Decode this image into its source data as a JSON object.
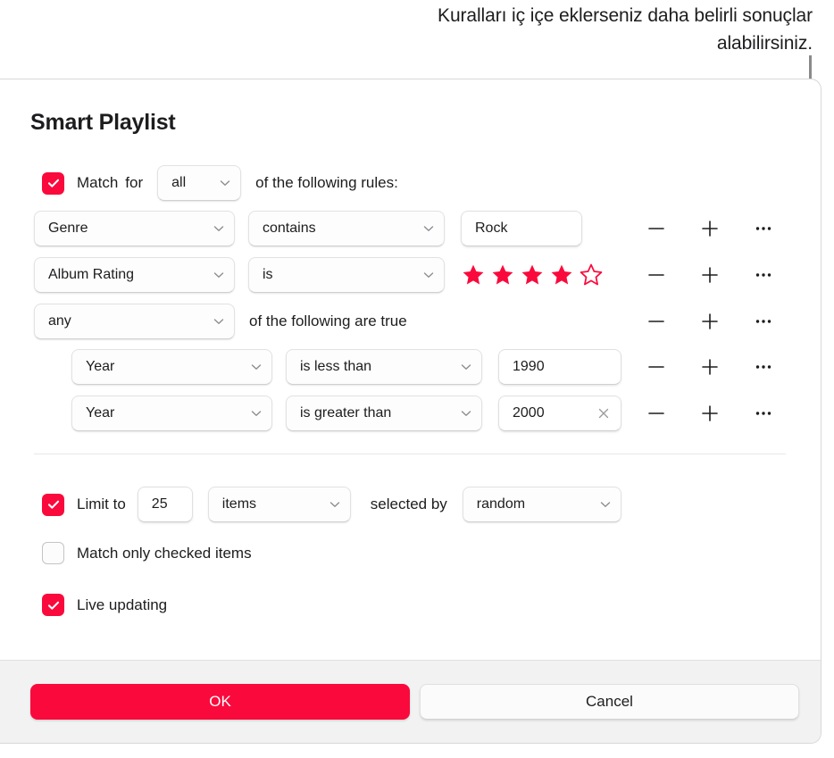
{
  "annotation": {
    "text": "Kuralları iç içe eklerseniz daha belirli sonuçlar alabilirsiniz."
  },
  "dialog": {
    "title": "Smart Playlist",
    "match": {
      "checked": true,
      "label": "Match",
      "for_label": "for",
      "scope_value": "all",
      "tail_label": "of the following rules:"
    },
    "rules": [
      {
        "field": "Genre",
        "operator": "contains",
        "value": "Rock",
        "value_type": "text",
        "nested": false
      },
      {
        "field": "Album Rating",
        "operator": "is",
        "value_type": "stars",
        "stars_filled": 4,
        "stars_total": 5,
        "nested": false
      },
      {
        "field": "any",
        "value_type": "group",
        "group_label": "of the following are true",
        "nested": false
      },
      {
        "field": "Year",
        "operator": "is less than",
        "value": "1990",
        "value_type": "text",
        "nested": true
      },
      {
        "field": "Year",
        "operator": "is greater than",
        "value": "2000",
        "value_type": "text",
        "has_clear": true,
        "nested": true
      }
    ],
    "row_actions": {
      "remove_label": "—",
      "add_label": "+",
      "more_label": "⋯"
    },
    "limit": {
      "checked": true,
      "label": "Limit to",
      "amount": "25",
      "unit": "items",
      "selected_by_label": "selected by",
      "selected_by": "random"
    },
    "match_only_checked": {
      "checked": false,
      "label": "Match only checked items"
    },
    "live_updating": {
      "checked": true,
      "label": "Live updating"
    },
    "footer": {
      "ok_label": "OK",
      "cancel_label": "Cancel"
    }
  },
  "colors": {
    "accent": "#fa0a3c",
    "text": "#1d1d1f",
    "footer_bg": "#f2f2f2",
    "callout_line": "#8a8a8a"
  }
}
